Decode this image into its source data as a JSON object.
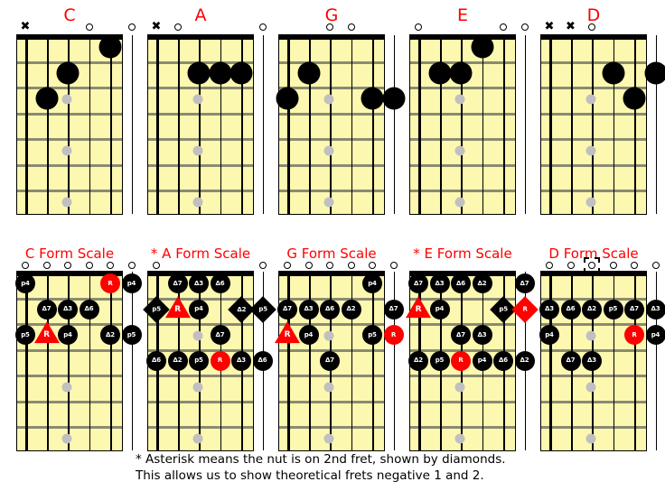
{
  "colors": {
    "title": "#ff0000",
    "board": "#fdf8b0",
    "note": "#000000",
    "root": "#ff0000",
    "inlay": "#c0c0c0",
    "fret": "#8a8a73"
  },
  "footer": {
    "line1": "* Asterisk means the nut is on 2nd fret, shown by diamonds.",
    "line2": "This allows us to show theoretical frets negative 1 and 2."
  },
  "chords": [
    {
      "name": "C",
      "title": "C",
      "markers": [
        "x",
        "",
        "",
        "o",
        "",
        "o"
      ],
      "notes": [
        {
          "string": 5,
          "fret": 3,
          "shape": "circle",
          "label": ""
        },
        {
          "string": 4,
          "fret": 2,
          "shape": "circle",
          "label": ""
        },
        {
          "string": 2,
          "fret": 1,
          "shape": "circle",
          "label": ""
        }
      ]
    },
    {
      "name": "A",
      "title": "A",
      "markers": [
        "x",
        "o",
        "",
        "",
        "",
        "o"
      ],
      "notes": [
        {
          "string": 4,
          "fret": 2,
          "shape": "circle",
          "label": ""
        },
        {
          "string": 3,
          "fret": 2,
          "shape": "circle",
          "label": ""
        },
        {
          "string": 2,
          "fret": 2,
          "shape": "circle",
          "label": ""
        }
      ]
    },
    {
      "name": "G",
      "title": "G",
      "markers": [
        "",
        "",
        "o",
        "o",
        "",
        ""
      ],
      "notes": [
        {
          "string": 6,
          "fret": 3,
          "shape": "circle",
          "label": ""
        },
        {
          "string": 5,
          "fret": 2,
          "shape": "circle",
          "label": ""
        },
        {
          "string": 2,
          "fret": 3,
          "shape": "circle",
          "label": ""
        },
        {
          "string": 1,
          "fret": 3,
          "shape": "circle",
          "label": ""
        }
      ]
    },
    {
      "name": "E",
      "title": "E",
      "markers": [
        "o",
        "",
        "",
        "",
        "o",
        "o"
      ],
      "notes": [
        {
          "string": 5,
          "fret": 2,
          "shape": "circle",
          "label": ""
        },
        {
          "string": 4,
          "fret": 2,
          "shape": "circle",
          "label": ""
        },
        {
          "string": 3,
          "fret": 1,
          "shape": "circle",
          "label": ""
        }
      ]
    },
    {
      "name": "D",
      "title": "D",
      "markers": [
        "x",
        "x",
        "o",
        "",
        "",
        ""
      ],
      "notes": [
        {
          "string": 3,
          "fret": 2,
          "shape": "circle",
          "label": ""
        },
        {
          "string": 2,
          "fret": 3,
          "shape": "circle",
          "label": ""
        },
        {
          "string": 1,
          "fret": 2,
          "shape": "circle",
          "label": ""
        }
      ]
    }
  ],
  "scales": [
    {
      "name": "c-form-scale",
      "title": "C Form Scale",
      "asterisk": false,
      "markers": [
        "o",
        "o",
        "o",
        "o",
        "o",
        "o"
      ],
      "boxed_marker": -1,
      "notes": [
        {
          "string": 6,
          "fret": 1,
          "shape": "circle",
          "label": "p4"
        },
        {
          "string": 2,
          "fret": 1,
          "shape": "circle",
          "label": "R",
          "color": "red"
        },
        {
          "string": 1,
          "fret": 1,
          "shape": "circle",
          "label": "p4"
        },
        {
          "string": 5,
          "fret": 2,
          "shape": "circle",
          "label": "Δ7"
        },
        {
          "string": 4,
          "fret": 2,
          "shape": "circle",
          "label": "Δ3"
        },
        {
          "string": 3,
          "fret": 2,
          "shape": "circle",
          "label": "Δ6"
        },
        {
          "string": 6,
          "fret": 3,
          "shape": "circle",
          "label": "p5"
        },
        {
          "string": 5,
          "fret": 3,
          "shape": "triangle",
          "label": "R"
        },
        {
          "string": 4,
          "fret": 3,
          "shape": "circle",
          "label": "p4"
        },
        {
          "string": 2,
          "fret": 3,
          "shape": "circle",
          "label": "Δ2"
        },
        {
          "string": 1,
          "fret": 3,
          "shape": "circle",
          "label": "p5"
        }
      ]
    },
    {
      "name": "a-form-scale",
      "title": "* A Form Scale",
      "asterisk": true,
      "markers": [
        "o",
        "",
        "",
        "",
        "",
        "o"
      ],
      "boxed_marker": -1,
      "notes": [
        {
          "string": 5,
          "fret": 1,
          "shape": "circle",
          "label": "Δ7"
        },
        {
          "string": 4,
          "fret": 1,
          "shape": "circle",
          "label": "Δ3"
        },
        {
          "string": 3,
          "fret": 1,
          "shape": "circle",
          "label": "Δ6"
        },
        {
          "string": 6,
          "fret": 2,
          "shape": "diamond",
          "label": "p5"
        },
        {
          "string": 5,
          "fret": 2,
          "shape": "triangle",
          "label": "R"
        },
        {
          "string": 4,
          "fret": 2,
          "shape": "circle",
          "label": "p4"
        },
        {
          "string": 2,
          "fret": 2,
          "shape": "diamond",
          "label": "Δ2"
        },
        {
          "string": 1,
          "fret": 2,
          "shape": "diamond",
          "label": "p5"
        },
        {
          "string": 3,
          "fret": 3,
          "shape": "circle",
          "label": "Δ7"
        },
        {
          "string": 6,
          "fret": 4,
          "shape": "circle",
          "label": "Δ6"
        },
        {
          "string": 5,
          "fret": 4,
          "shape": "circle",
          "label": "Δ2"
        },
        {
          "string": 4,
          "fret": 4,
          "shape": "circle",
          "label": "p5"
        },
        {
          "string": 3,
          "fret": 4,
          "shape": "circle",
          "label": "R",
          "color": "red"
        },
        {
          "string": 2,
          "fret": 4,
          "shape": "circle",
          "label": "Δ3"
        },
        {
          "string": 1,
          "fret": 4,
          "shape": "circle",
          "label": "Δ6"
        }
      ]
    },
    {
      "name": "g-form-scale",
      "title": "G Form Scale",
      "asterisk": false,
      "markers": [
        "o",
        "o",
        "o",
        "o",
        "o",
        "o"
      ],
      "boxed_marker": -1,
      "notes": [
        {
          "string": 2,
          "fret": 1,
          "shape": "circle",
          "label": "p4"
        },
        {
          "string": 6,
          "fret": 2,
          "shape": "circle",
          "label": "Δ7"
        },
        {
          "string": 5,
          "fret": 2,
          "shape": "circle",
          "label": "Δ3"
        },
        {
          "string": 4,
          "fret": 2,
          "shape": "circle",
          "label": "Δ6"
        },
        {
          "string": 3,
          "fret": 2,
          "shape": "circle",
          "label": "Δ2"
        },
        {
          "string": 1,
          "fret": 2,
          "shape": "circle",
          "label": "Δ7"
        },
        {
          "string": 6,
          "fret": 3,
          "shape": "triangle",
          "label": "R"
        },
        {
          "string": 5,
          "fret": 3,
          "shape": "circle",
          "label": "p4"
        },
        {
          "string": 2,
          "fret": 3,
          "shape": "circle",
          "label": "p5"
        },
        {
          "string": 1,
          "fret": 3,
          "shape": "circle",
          "label": "R",
          "color": "red"
        },
        {
          "string": 4,
          "fret": 4,
          "shape": "circle",
          "label": "Δ7"
        }
      ]
    },
    {
      "name": "e-form-scale",
      "title": "* E Form Scale",
      "asterisk": true,
      "markers": [],
      "boxed_marker": -1,
      "notes": [
        {
          "string": 6,
          "fret": 1,
          "shape": "circle",
          "label": "Δ7"
        },
        {
          "string": 5,
          "fret": 1,
          "shape": "circle",
          "label": "Δ3"
        },
        {
          "string": 4,
          "fret": 1,
          "shape": "circle",
          "label": "Δ6"
        },
        {
          "string": 3,
          "fret": 1,
          "shape": "circle",
          "label": "Δ2"
        },
        {
          "string": 1,
          "fret": 1,
          "shape": "circle",
          "label": "Δ7"
        },
        {
          "string": 6,
          "fret": 2,
          "shape": "triangle",
          "label": "R"
        },
        {
          "string": 5,
          "fret": 2,
          "shape": "circle",
          "label": "p4"
        },
        {
          "string": 2,
          "fret": 2,
          "shape": "diamond",
          "label": "p5"
        },
        {
          "string": 1,
          "fret": 2,
          "shape": "diamond",
          "label": "R",
          "color": "red"
        },
        {
          "string": 4,
          "fret": 3,
          "shape": "circle",
          "label": "Δ7"
        },
        {
          "string": 3,
          "fret": 3,
          "shape": "circle",
          "label": "Δ3"
        },
        {
          "string": 6,
          "fret": 4,
          "shape": "circle",
          "label": "Δ2"
        },
        {
          "string": 5,
          "fret": 4,
          "shape": "circle",
          "label": "p5"
        },
        {
          "string": 4,
          "fret": 4,
          "shape": "circle",
          "label": "R",
          "color": "red"
        },
        {
          "string": 3,
          "fret": 4,
          "shape": "circle",
          "label": "p4"
        },
        {
          "string": 2,
          "fret": 4,
          "shape": "circle",
          "label": "Δ6"
        },
        {
          "string": 1,
          "fret": 4,
          "shape": "circle",
          "label": "Δ2"
        }
      ]
    },
    {
      "name": "d-form-scale",
      "title": "D Form Scale",
      "asterisk": false,
      "markers": [
        "o",
        "o",
        "o",
        "o",
        "o",
        "o"
      ],
      "boxed_marker": 2,
      "notes": [
        {
          "string": 6,
          "fret": 2,
          "shape": "circle",
          "label": "Δ3"
        },
        {
          "string": 5,
          "fret": 2,
          "shape": "circle",
          "label": "Δ6"
        },
        {
          "string": 4,
          "fret": 2,
          "shape": "circle",
          "label": "Δ2"
        },
        {
          "string": 3,
          "fret": 2,
          "shape": "circle",
          "label": "p5"
        },
        {
          "string": 2,
          "fret": 2,
          "shape": "circle",
          "label": "Δ7"
        },
        {
          "string": 1,
          "fret": 2,
          "shape": "circle",
          "label": "Δ3"
        },
        {
          "string": 6,
          "fret": 3,
          "shape": "circle",
          "label": "p4"
        },
        {
          "string": 2,
          "fret": 3,
          "shape": "circle",
          "label": "R",
          "color": "red"
        },
        {
          "string": 1,
          "fret": 3,
          "shape": "circle",
          "label": "p4"
        },
        {
          "string": 5,
          "fret": 4,
          "shape": "circle",
          "label": "Δ7"
        },
        {
          "string": 4,
          "fret": 4,
          "shape": "circle",
          "label": "Δ3"
        }
      ]
    }
  ]
}
